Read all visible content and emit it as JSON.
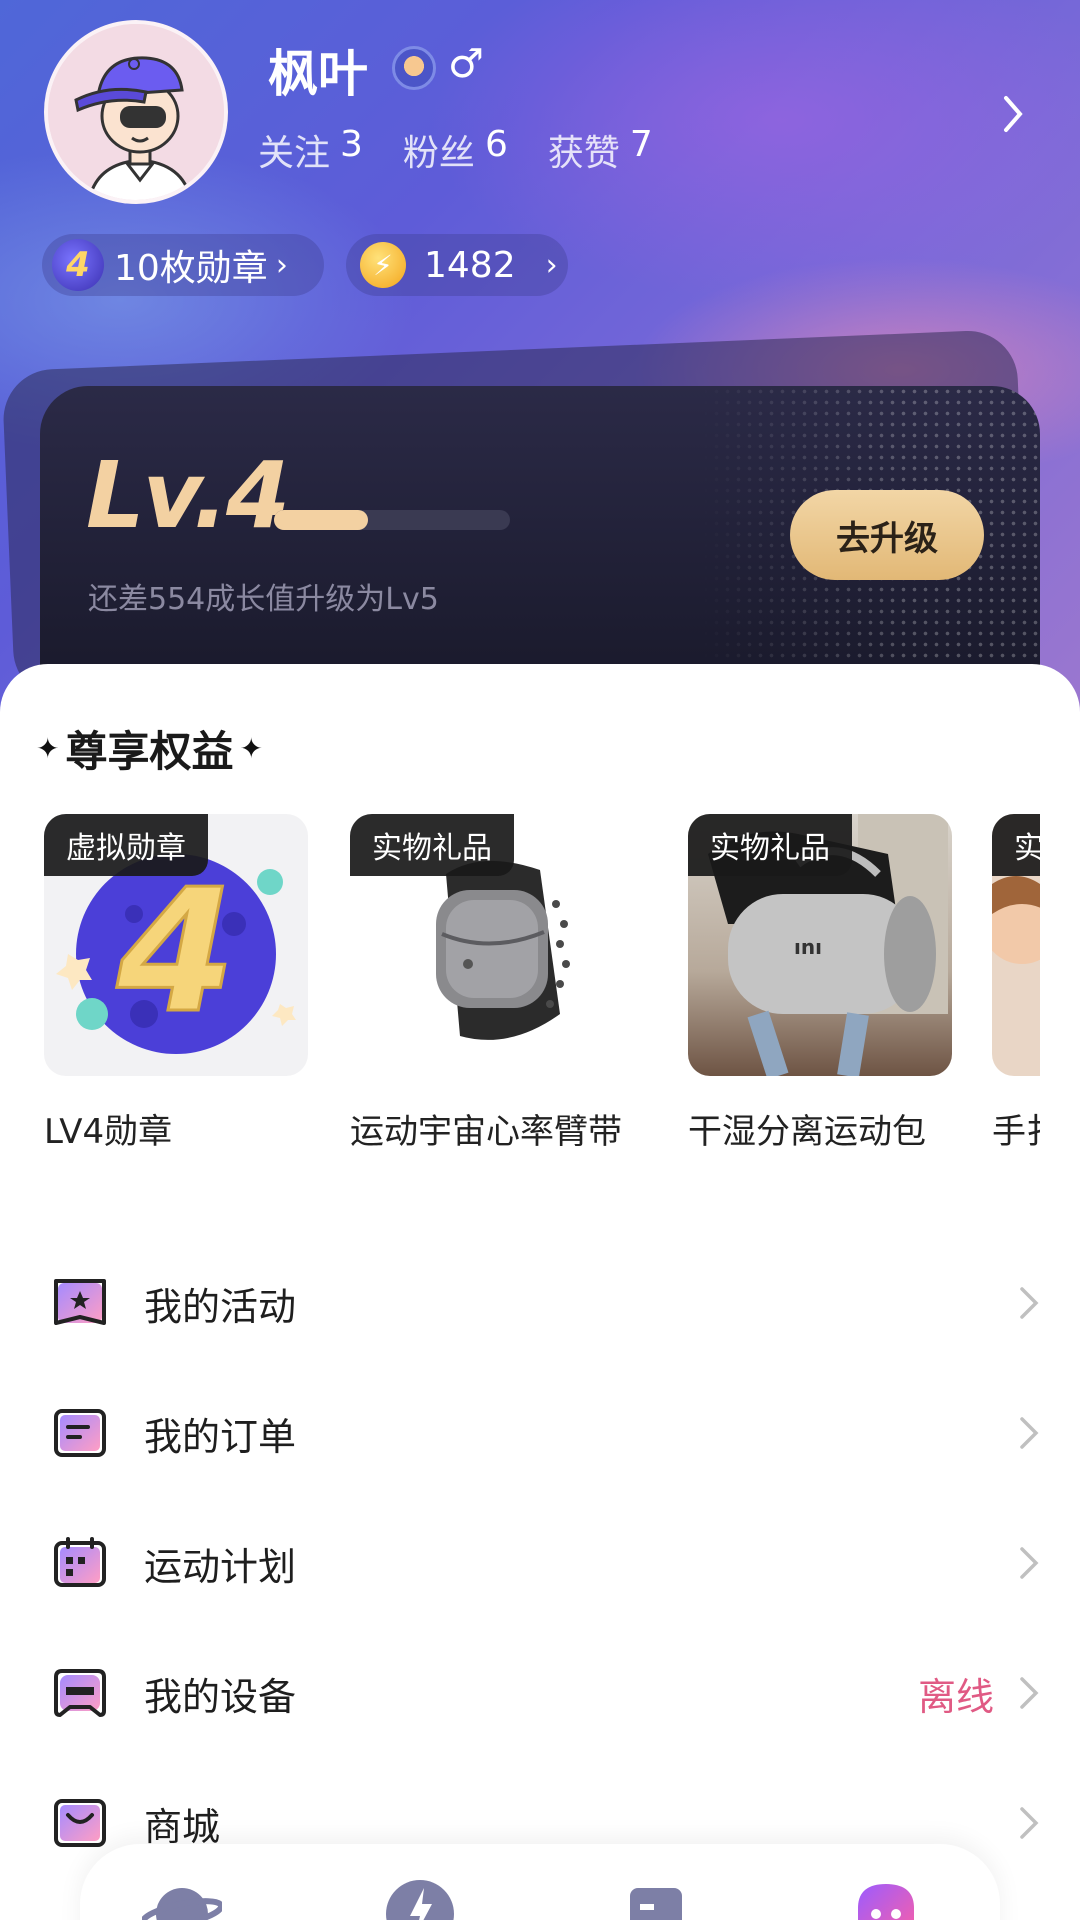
{
  "profile": {
    "username": "枫叶",
    "gender_icon": "male-icon",
    "stats": [
      {
        "label": "关注",
        "value": "3"
      },
      {
        "label": "粉丝",
        "value": "6"
      },
      {
        "label": "获赞",
        "value": "7"
      }
    ]
  },
  "pills": {
    "medal_label": "10枚勋章",
    "medal_digit": "4",
    "coin_value": "1482"
  },
  "level": {
    "title": "Lv.4",
    "progress": 0.4,
    "subtitle": "还差554成长值升级为Lv5",
    "upgrade_button": "去升级"
  },
  "benefits": {
    "title": "尊享权益",
    "items": [
      {
        "tag": "虚拟勋章",
        "name": "LV4勋章"
      },
      {
        "tag": "实物礼品",
        "name": "运动宇宙心率臂带"
      },
      {
        "tag": "实物礼品",
        "name": "干湿分离运动包"
      },
      {
        "tag": "实",
        "name": "手扌"
      }
    ]
  },
  "menu": [
    {
      "label": "我的活动",
      "icon": "activity-icon",
      "status": ""
    },
    {
      "label": "我的订单",
      "icon": "order-icon",
      "status": ""
    },
    {
      "label": "运动计划",
      "icon": "calendar-icon",
      "status": ""
    },
    {
      "label": "我的设备",
      "icon": "device-icon",
      "status": "离线"
    },
    {
      "label": "商城",
      "icon": "shop-icon",
      "status": ""
    }
  ],
  "colors": {
    "accent_gold": "#f3d1a2",
    "status_offline": "#e05a84",
    "tab_active": "#d84aa8"
  }
}
